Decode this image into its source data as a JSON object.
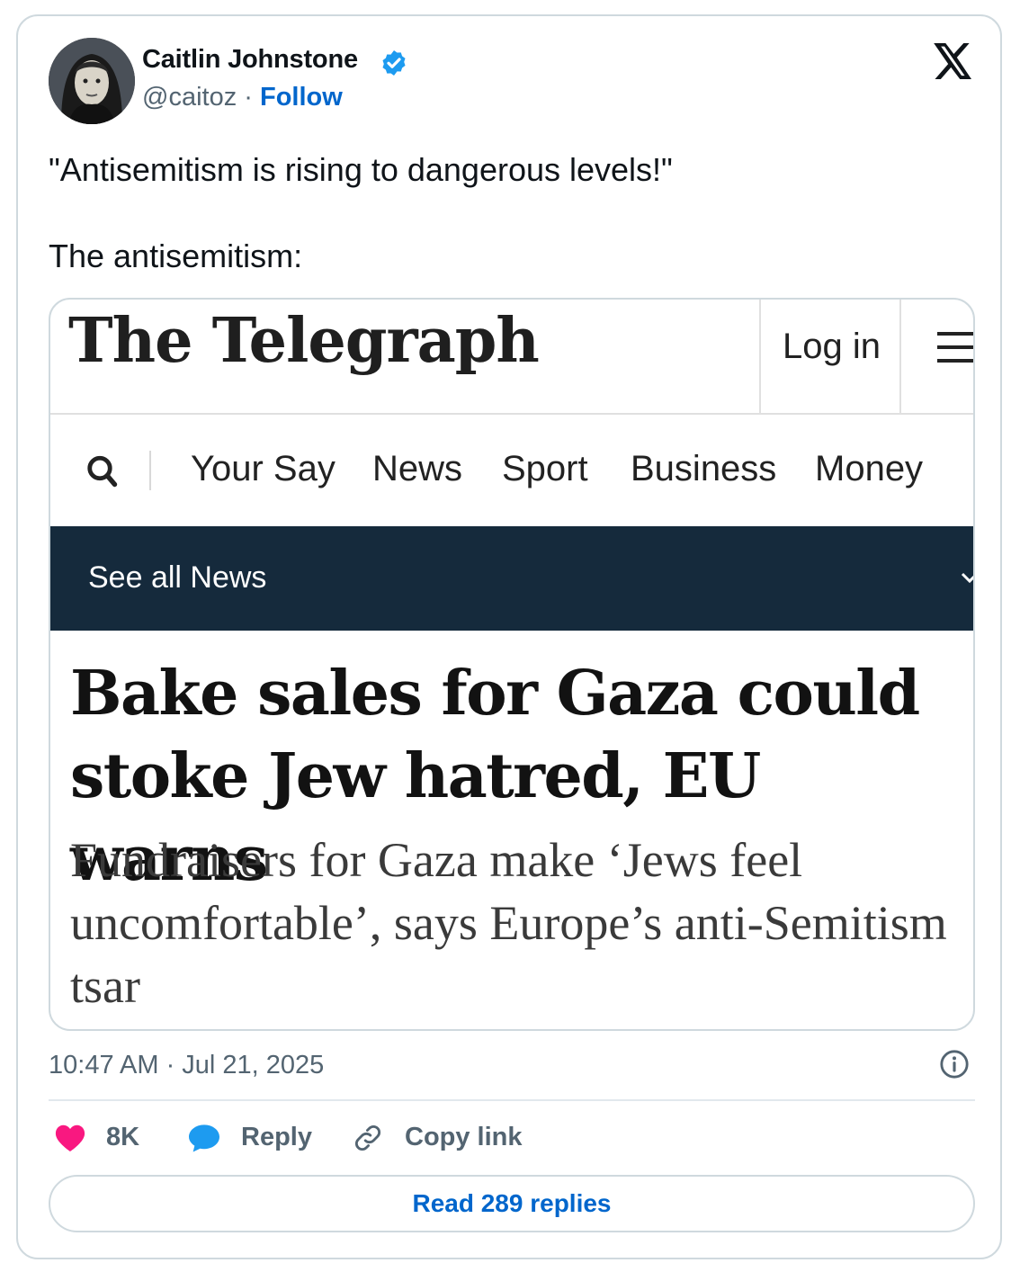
{
  "author": {
    "name": "Caitlin Johnstone",
    "handle": "@caitoz",
    "separator": "·",
    "follow_label": "Follow"
  },
  "icons": {
    "verified": "verified-badge-icon",
    "x_logo": "x-logo-icon",
    "info": "info-icon",
    "like": "heart-icon",
    "reply": "speech-bubble-icon",
    "copy_link": "link-icon"
  },
  "tweet": {
    "line1": "\"Antisemitism is rising to dangerous levels!\"",
    "line2": "The antisemitism:"
  },
  "embedded_screenshot": {
    "masthead": "The Telegraph",
    "login_label": "Log in",
    "nav_items": [
      "Your Say",
      "News",
      "Sport",
      "Business",
      "Money"
    ],
    "section_bar_label": "See all News",
    "headline": "Bake sales for Gaza could stoke Jew hatred, EU warns",
    "standfirst": "Fundraisers for Gaza make ‘Jews feel uncomfortable’, says Europe’s anti-Semitism tsar"
  },
  "meta": {
    "timestamp": "10:47 AM · Jul 21, 2025"
  },
  "actions": {
    "likes": "8K",
    "reply_label": "Reply",
    "copy_link_label": "Copy link",
    "read_replies_label": "Read 289 replies"
  },
  "colors": {
    "link_blue": "#0066cc",
    "verified_blue": "#1d9bf0",
    "like_pink": "#f91880",
    "telegraph_navy": "#152a3c",
    "muted_text": "#536471"
  }
}
